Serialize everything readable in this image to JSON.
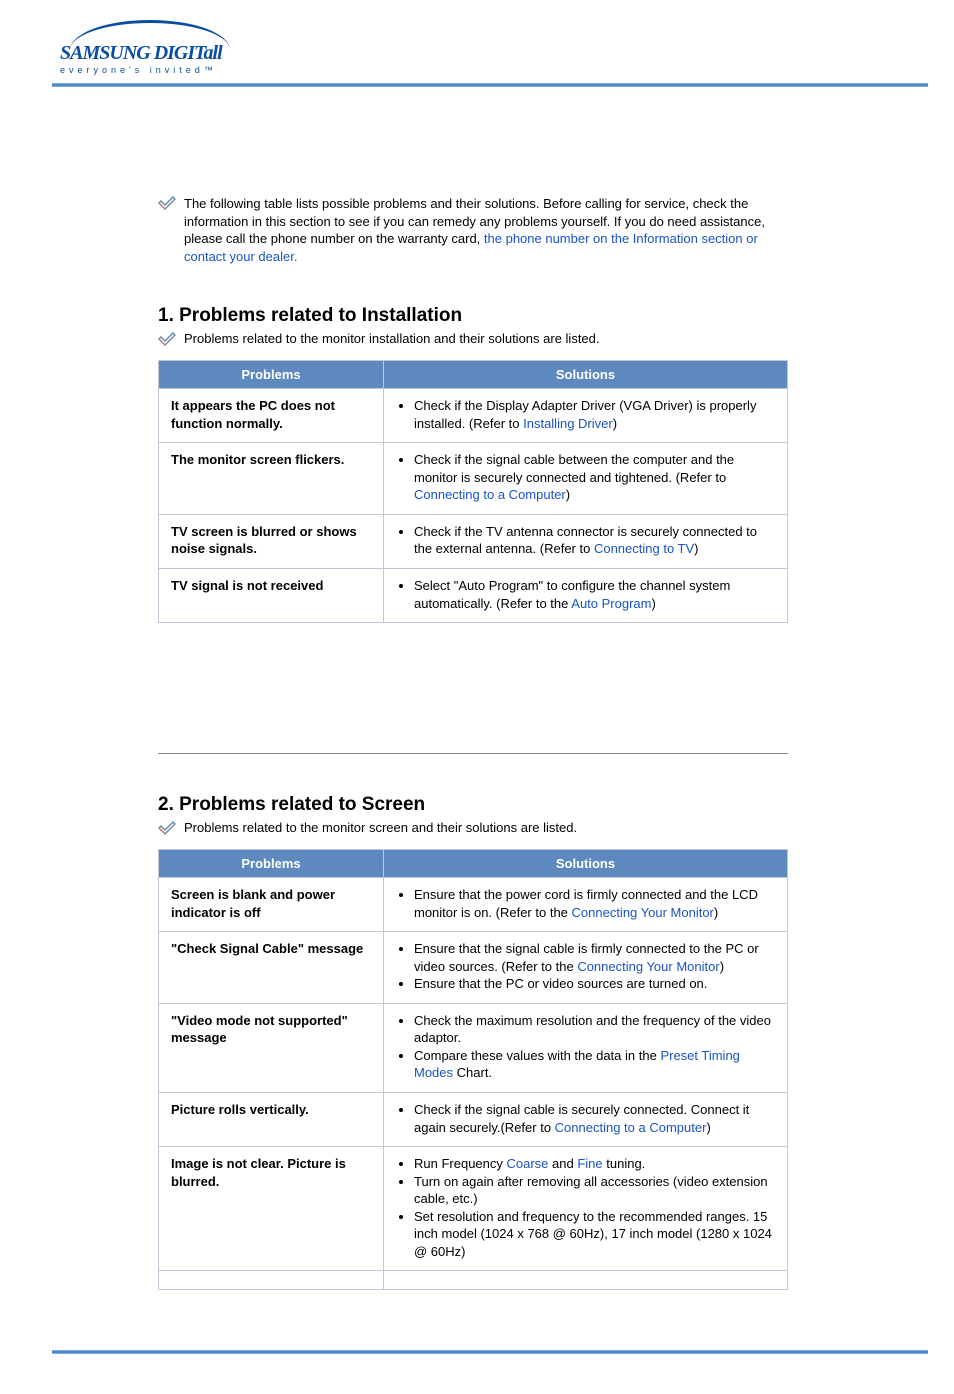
{
  "brand": {
    "main": "SAMSUNG DIGIT",
    "main_italic": "all",
    "tagline": "everyone's invited™"
  },
  "intro": {
    "text1": "The following table lists possible problems and their solutions. Before calling for service, check the information in this section to see if you can remedy any problems yourself. If you do need assistance, please call the phone number on the warranty card, ",
    "link": "the phone number on the Information section or contact your dealer.",
    "text2": ""
  },
  "section1": {
    "heading": "1. Problems related to Installation",
    "sub": "Problems related to the monitor installation and their solutions are listed.",
    "th_problems": "Problems",
    "th_solutions": "Solutions",
    "rows": [
      {
        "problem": "It appears the PC does not function normally.",
        "sol_pre": "Check if the Display Adapter Driver (VGA Driver) is properly installed. (Refer to ",
        "sol_link": "Installing Driver",
        "sol_post": ")"
      },
      {
        "problem": "The monitor screen flickers.",
        "sol_pre": "Check if the signal cable between the computer and the monitor is securely connected and tightened. (Refer to ",
        "sol_link": "Connecting to a Computer",
        "sol_post": ")"
      },
      {
        "problem": "TV screen is blurred or shows noise signals.",
        "sol_pre": "Check if the TV antenna connector is securely connected to the external antenna. (Refer to ",
        "sol_link": "Connecting to TV",
        "sol_post": ")"
      },
      {
        "problem": "TV signal is not received",
        "sol_pre": "Select \"Auto Program\" to configure the channel system automatically. (Refer to the ",
        "sol_link": "Auto Program",
        "sol_post": ")"
      }
    ]
  },
  "section2": {
    "heading": "2. Problems related to Screen",
    "sub": "Problems related to the monitor screen and their solutions are listed.",
    "th_problems": "Problems",
    "th_solutions": "Solutions",
    "rows": [
      {
        "problem": "Screen is blank and power indicator is off",
        "items": [
          {
            "pre": "Ensure that the power cord is firmly connected and the LCD monitor is on. (Refer to the ",
            "link": "Connecting Your Monitor",
            "post": ")"
          }
        ]
      },
      {
        "problem": "\"Check Signal Cable\" message",
        "items": [
          {
            "pre": "Ensure that the signal cable is firmly connected to the PC or video sources. (Refer to the ",
            "link": "Connecting Your Monitor",
            "post": ")"
          },
          {
            "pre": "Ensure that the PC or video sources are turned on.",
            "link": "",
            "post": ""
          }
        ]
      },
      {
        "problem": "\"Video mode not supported\" message",
        "items": [
          {
            "pre": "Check the maximum resolution and the frequency of the video adaptor.",
            "link": "",
            "post": ""
          },
          {
            "pre": "Compare these values with the data in the ",
            "link": "Preset Timing Modes",
            "post": " Chart."
          }
        ]
      },
      {
        "problem": "Picture rolls vertically.",
        "items": [
          {
            "pre": "Check if the signal cable is securely connected. Connect it again securely.(Refer to ",
            "link": "Connecting to a Computer",
            "post": ")"
          }
        ]
      },
      {
        "problem": "Image is not clear. Picture is blurred.",
        "items_special": {
          "a_pre": "Run Frequency ",
          "a_link1": "Coarse",
          "a_mid": " and ",
          "a_link2": "Fine",
          "a_post": " tuning.",
          "b": "Turn on again after removing all accessories (video extension cable, etc.)",
          "c": "Set resolution and frequency to the recommended ranges. 15 inch model (1024 x 768 @ 60Hz), 17 inch model (1280 x 1024 @ 60Hz)"
        }
      }
    ]
  }
}
